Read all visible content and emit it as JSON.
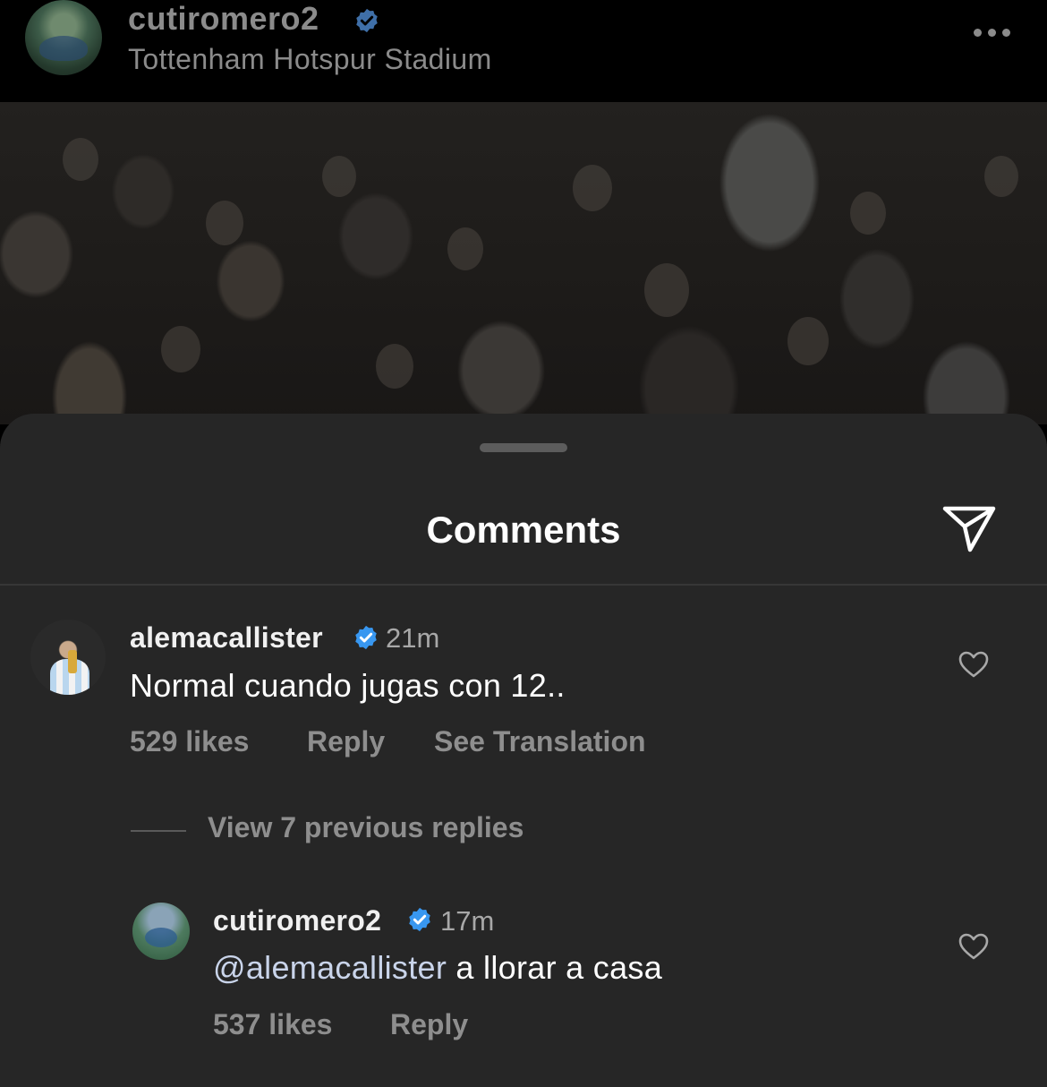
{
  "post": {
    "username": "cutiromero2",
    "location": "Tottenham Hotspur Stadium",
    "more_icon": "more-horizontal-icon"
  },
  "sheet": {
    "title": "Comments",
    "share_icon": "send-icon"
  },
  "comments": [
    {
      "username": "alemacallister",
      "verified": true,
      "time": "21m",
      "text": "Normal cuando jugas con 12..",
      "likes": "529 likes",
      "reply_label": "Reply",
      "translate_label": "See Translation"
    }
  ],
  "replies_toggle": "View 7 previous replies",
  "replies": [
    {
      "username": "cutiromero2",
      "verified": true,
      "time": "17m",
      "mention": "@alemacallister",
      "text": " a llorar a casa",
      "likes": "537 likes",
      "reply_label": "Reply"
    }
  ],
  "colors": {
    "verified_badge": "#3897f0",
    "sheet_background": "#262626",
    "muted_text": "#8e8e8e"
  }
}
